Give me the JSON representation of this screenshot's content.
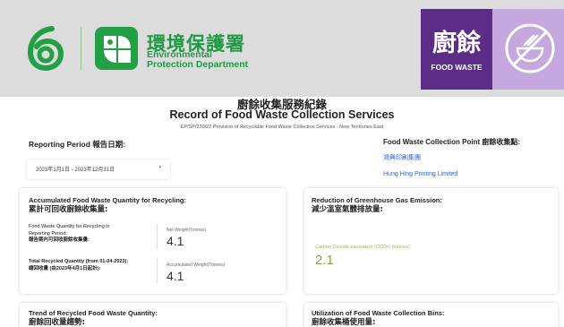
{
  "header": {
    "epd_name_zh": "環境保護署",
    "epd_name_en_line1": "Environmental",
    "epd_name_en_line2": "Protection Department",
    "food_waste_zh": "廚餘",
    "food_waste_en": "FOOD WASTE",
    "colors": {
      "banner": "#dcdcdc",
      "epd_green": "#23a046",
      "food_waste_purple": "#5b2d87",
      "lavender": "#c5a8de"
    }
  },
  "page": {
    "title_zh": "廚餘收集服務紀錄",
    "title_en": "Record of Food Waste Collection Services",
    "subtitle": "EP/SP/230/22 Provision of Recyclable Food Waste Collection Services - New Territories East"
  },
  "filters": {
    "reporting_period_label": "Reporting Period 報告日期:",
    "reporting_period_value": "2023年1月1日 - 2023年12月31日"
  },
  "collection_point": {
    "label": "Food Waste Collection Point 廚餘收集點:",
    "name_zh": "鴻興印刷集團",
    "name_en": "Hung Hing Printing Limited"
  },
  "accumulated": {
    "title_en": "Accumulated Food Waste Quantity for Recycling:",
    "title_zh": "累計可回收廚餘收集量:",
    "period_label_en_1": "Food Waste Quantity for Recycling in",
    "period_label_en_2": "Reporting Period:",
    "period_label_zh": "報告期內可回收廚餘收集量:",
    "period_field_label": "Net Weight(Tonnes)",
    "period_value": "4.1",
    "total_label_en": "Total Recycled Quantity (from 01-04-2023):",
    "total_label_zh": "總回收量 (由2023年4月1日起計):",
    "total_field_label": "Accumulated Weight(Tonnes)",
    "total_value": "4.1"
  },
  "ghg": {
    "title_en": "Reduction of Greenhouse Gas Emission:",
    "title_zh": "減少溫室氣體排放量:",
    "field_label": "Carbon Dioxide equivalent (CO2e) (tonnes)",
    "value": "2.1"
  },
  "trend": {
    "title_en": "Trend of Recycled Food Waste Quantity:",
    "title_zh": "廚餘回收量趨勢:"
  },
  "bins": {
    "title_en": "Utilization of Food Waste Collection Bins:",
    "title_zh": "廚餘收集桶使用量:"
  }
}
